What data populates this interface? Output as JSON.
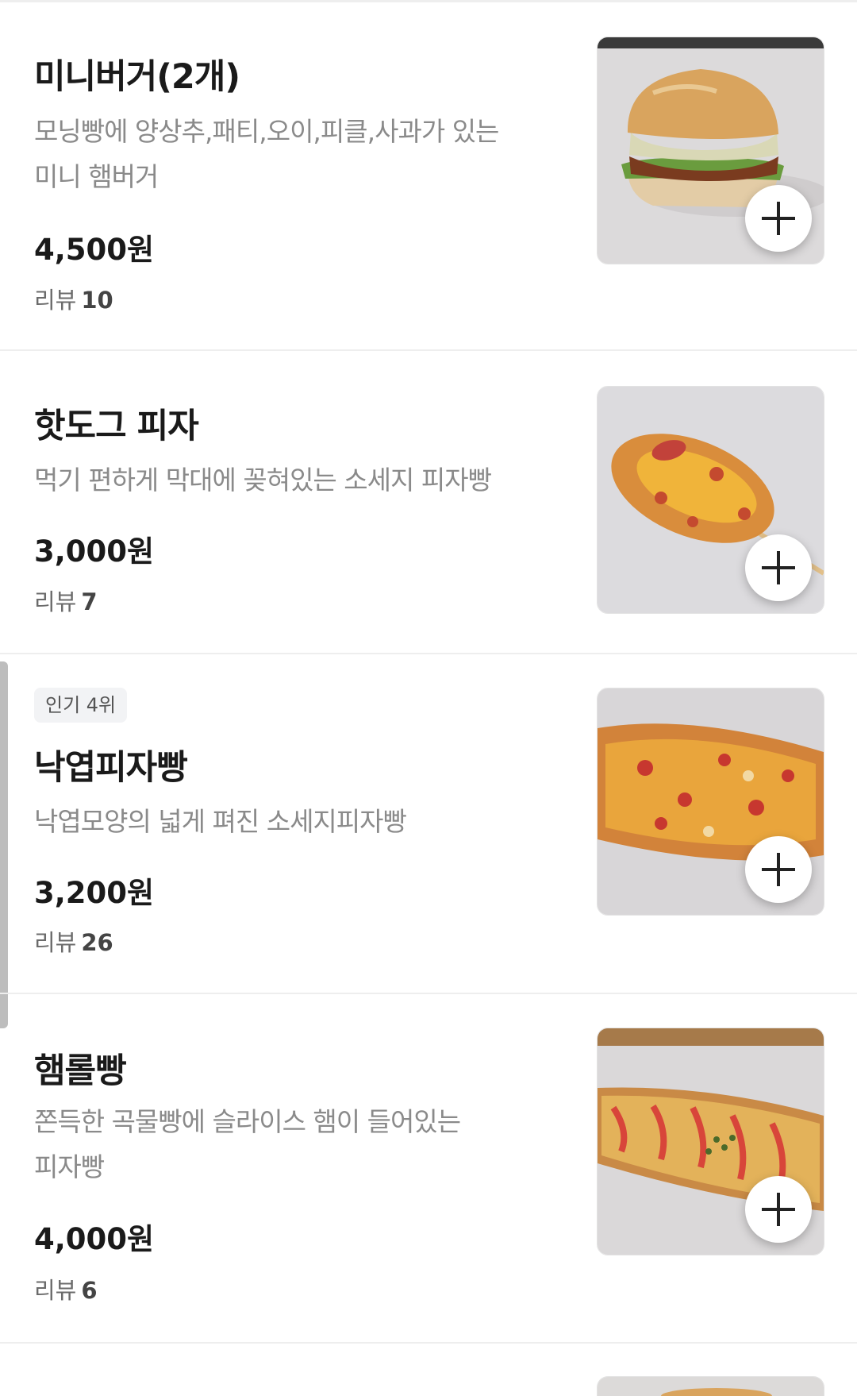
{
  "menu": {
    "items": [
      {
        "name": "미니버거(2개)",
        "desc_lines": [
          "모닝빵에 양상추,패티,오이,피클,사과가 있는",
          "미니 햄버거"
        ],
        "price": "4,500원",
        "review_label": "리뷰",
        "review_count": "10",
        "image": "mini-burger-photo"
      },
      {
        "name": "핫도그 피자",
        "desc_lines": [
          "먹기 편하게 막대에 꽂혀있는 소세지 피자빵"
        ],
        "price": "3,000원",
        "review_label": "리뷰",
        "review_count": "7",
        "image": "hotdog-pizza-photo"
      },
      {
        "badge": "인기 4위",
        "name": "낙엽피자빵",
        "desc_lines": [
          "낙엽모양의 넓게 펴진 소세지피자빵"
        ],
        "price": "3,200원",
        "review_label": "리뷰",
        "review_count": "26",
        "image": "leaf-pizza-bread-photo"
      },
      {
        "name": "햄롤빵",
        "desc_lines": [
          "쫀득한 곡물빵에 슬라이스 햄이 들어있는",
          "피자빵"
        ],
        "price": "4,000원",
        "review_label": "리뷰",
        "review_count": "6",
        "image": "ham-roll-bread-photo"
      }
    ],
    "add_icon": "plus-icon"
  }
}
